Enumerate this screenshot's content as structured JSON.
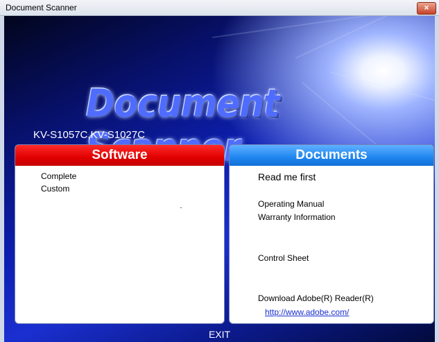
{
  "window": {
    "title": "Document Scanner",
    "close_label": "×"
  },
  "logo": {
    "text": "Document Scanner"
  },
  "model": "KV-S1057C,KV-S1027C",
  "software": {
    "header": "Software",
    "items": [
      "Complete",
      "Custom"
    ]
  },
  "documents": {
    "header": "Documents",
    "read_me": "Read me first",
    "operating_manual": "Operating Manual",
    "warranty": "Warranty Information",
    "control_sheet": "Control Sheet",
    "download_adobe": "Download Adobe(R) Reader(R)",
    "adobe_url": "http://www.adobe.com/"
  },
  "exit_label": "EXIT",
  "colors": {
    "software_header": "#e00000",
    "documents_header": "#1f86f0",
    "background": "#0d1fb0"
  }
}
